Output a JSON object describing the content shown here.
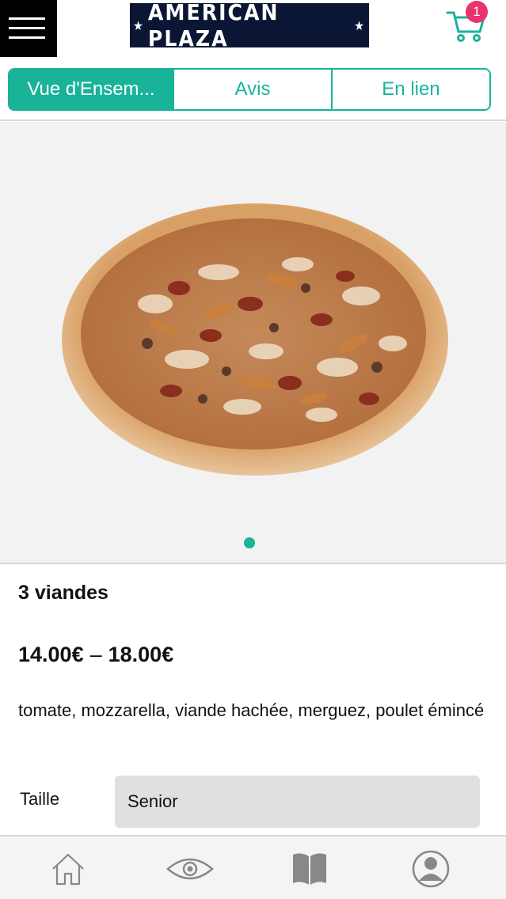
{
  "header": {
    "logo_text": "AMERICAN PLAZA",
    "cart_count": "1",
    "menu_icon": "hamburger-icon",
    "cart_icon": "cart-icon"
  },
  "tabs": [
    {
      "label": "Vue d'Ensem...",
      "active": true
    },
    {
      "label": "Avis",
      "active": false
    },
    {
      "label": "En lien",
      "active": false
    }
  ],
  "gallery": {
    "page_count": 1,
    "current": 1
  },
  "product": {
    "title": "3 viandes",
    "price_min": "14.00€",
    "price_sep": "–",
    "price_max": "18.00€",
    "description": "tomate, mozzarella, viande hachée, merguez, poulet émincé",
    "size_label": "Taille",
    "size_value": "Senior"
  },
  "bottom_nav": [
    {
      "icon": "home-icon"
    },
    {
      "icon": "eye-icon"
    },
    {
      "icon": "book-icon"
    },
    {
      "icon": "profile-icon"
    }
  ],
  "colors": {
    "accent": "#19b39a",
    "badge": "#e8336d",
    "logo_bg": "#0a1633"
  }
}
